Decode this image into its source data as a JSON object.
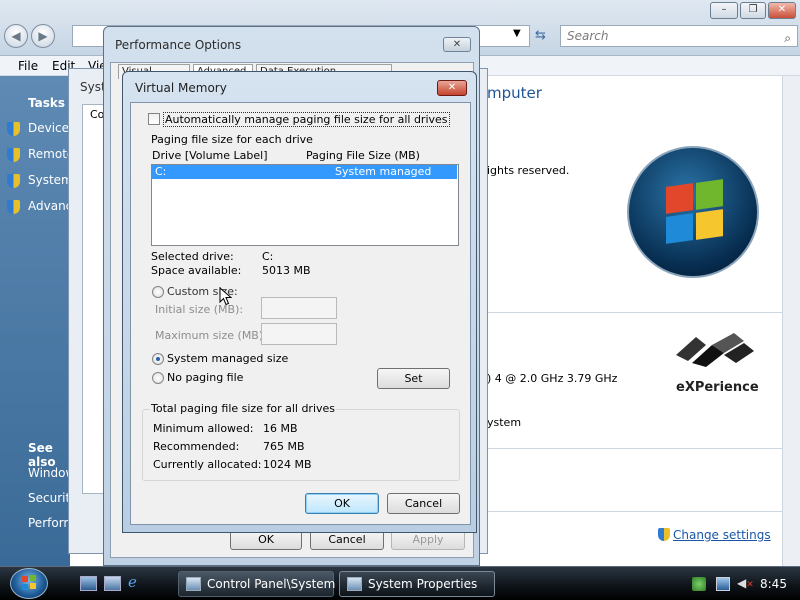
{
  "explorer": {
    "search_placeholder": "Search",
    "menu": {
      "file": "File",
      "edit": "Edit",
      "view": "Vie"
    },
    "sidebar": {
      "tasks_heading": "Tasks",
      "tasks": [
        "Device M",
        "Remote",
        "System",
        "Advanc"
      ],
      "see_also_heading": "See also",
      "see_also": [
        "Window",
        "Security",
        "Perform"
      ]
    },
    "main_title": "mputer",
    "rights_text": "ights reserved.",
    "processor_text": ") 4   @ 2.0 GHz   3.79 GHz",
    "system_type_text": "ystem",
    "experience_label": "eXPerience",
    "change_settings": "Change settings",
    "caption_buttons": {
      "minimize": "–",
      "restore": "❐",
      "close": "✕"
    }
  },
  "system_properties": {
    "title_fragment": "Syst",
    "tab_fragment": "Co"
  },
  "performance_options": {
    "title": "Performance Options",
    "tabs": [
      "Visual Effects",
      "Advanced",
      "Data Execution Prevention"
    ],
    "buttons": {
      "ok": "OK",
      "cancel": "Cancel",
      "apply": "Apply"
    }
  },
  "virtual_memory": {
    "title": "Virtual Memory",
    "auto_manage_label": "Automatically manage paging file size for all drives",
    "auto_manage_checked": false,
    "group_title": "Paging file size for each drive",
    "col_drive": "Drive  [Volume Label]",
    "col_size": "Paging File Size (MB)",
    "drives": [
      {
        "drive": "C:",
        "size": "System managed",
        "selected": true
      }
    ],
    "selected_drive_label": "Selected drive:",
    "selected_drive_value": "C:",
    "space_available_label": "Space available:",
    "space_available_value": "5013 MB",
    "custom_size_label": "Custom size:",
    "initial_size_label": "Initial size (MB):",
    "maximum_size_label": "Maximum size (MB):",
    "system_managed_label": "System managed size",
    "no_paging_label": "No paging file",
    "selected_option": "System managed size",
    "set_button": "Set",
    "totals_title": "Total paging file size for all drives",
    "min_allowed_label": "Minimum allowed:",
    "min_allowed_value": "16 MB",
    "recommended_label": "Recommended:",
    "recommended_value": "765 MB",
    "current_label": "Currently allocated:",
    "current_value": "1024 MB",
    "ok_button": "OK",
    "cancel_button": "Cancel",
    "close_glyph": "✕"
  },
  "taskbar": {
    "items": [
      {
        "label": "Control Panel\\System",
        "active": false
      },
      {
        "label": "System Properties",
        "active": true
      }
    ],
    "clock": "8:45"
  },
  "colors": {
    "selection": "#3399ff",
    "sidebar": "#4a78a6",
    "link": "#1a56a8",
    "close_red": "#c5432d"
  }
}
